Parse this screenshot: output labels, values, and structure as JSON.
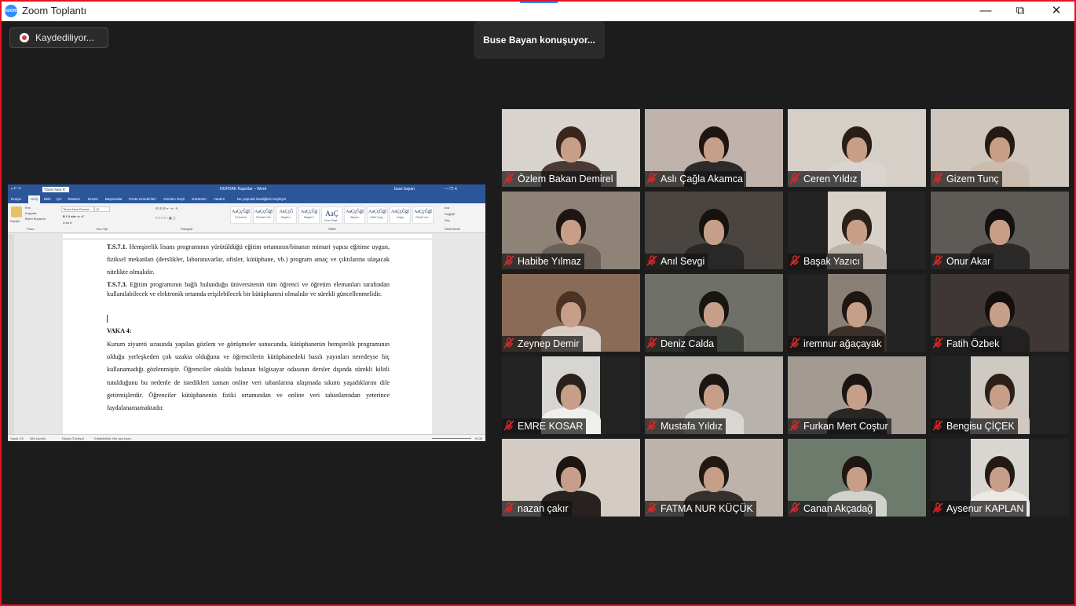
{
  "window": {
    "title": "Zoom Toplantı",
    "app_icon": "zoom-icon",
    "controls": {
      "minimize": "—",
      "maximize": "⧉",
      "close": "✕"
    }
  },
  "recording": {
    "label": "Kaydediliyor...",
    "icon": "record-icon",
    "color": "#d9373c"
  },
  "speaker_banner": "Buse Bayan konuşuyor...",
  "shared_screen": {
    "word": {
      "font_name": "Times New R",
      "doc_title": "HGPDAK Raporlar  –  Word",
      "user": "buse bayan",
      "tabs": [
        "Dosya",
        "Giriş",
        "Ekle",
        "Çiz",
        "Tasarım",
        "Düzen",
        "Başvurular",
        "Posta Gönderileri",
        "Gözden Geçir",
        "Görünüm",
        "Yardım",
        "Ne yapmak istediğinizi söyleyin"
      ],
      "active_tab": "Giriş",
      "clipboard": {
        "paste": "Yapıştır",
        "cut": "Kes",
        "copy": "Kopyala",
        "format_painter": "Biçim Boyacısı",
        "group": "Pano"
      },
      "font_group": {
        "font": "Times New Roman",
        "size": "12",
        "label": "Yazı Tipi"
      },
      "paragraph_label": "Paragraf",
      "styles_label": "Stiller",
      "editing": {
        "find": "Ara",
        "replace": "Değiştir",
        "select": "Seç",
        "label": "Düzenleme"
      },
      "styles": [
        {
          "sample": "AaÇçĞğİ",
          "name": "¶ Normal"
        },
        {
          "sample": "AaÇçĞğİ",
          "name": "¶ Aralık Yok"
        },
        {
          "sample": "AaÇçĞ",
          "name": "Başlık 1"
        },
        {
          "sample": "AaÇçĞğ",
          "name": "Başlık 2"
        },
        {
          "sample": "AaÇ",
          "name": "Konu Başl..."
        },
        {
          "sample": "AaÇçĞğİ",
          "name": "Altyazı"
        },
        {
          "sample": "AaÇçĞğİ",
          "name": "Hafif Vurg..."
        },
        {
          "sample": "AaÇçĞğİ",
          "name": "Vurgu"
        },
        {
          "sample": "AaÇçĞğİ",
          "name": "Güçlü Vur..."
        }
      ],
      "status": {
        "page": "Sayfa 2/3",
        "words": "365 sözcük",
        "language": "Türkçe (Türkiye)",
        "accessibility": "Erişilebilirlik: Her şey hazır",
        "zoom": "%130"
      },
      "document": {
        "p1_label": "T.S.7.1.",
        "p1_text": " Hemşirelik lisans programının yürütüldüğü eğitim ortamının/binanın mimari yapısı eğitime uygun, fiziksel mekanları (derslikler, laboratuvarlar, ofisler, kütüphane, vb.) program amaç ve çıktılarına ulaşacak nitelikte olmalıdır.",
        "p2_label": "T.S.7.3.",
        "p2_text": " Eğitim programının bağlı bulunduğu üniversitenin tüm öğrenci ve öğretim elemanları tarafından kullanılabilecek ve elektronik ortamda erişilebilecek bir kütüphanesi olmalıdır ve sürekli güncellenmelidir.",
        "heading": "VAKA 4:",
        "p3_text": " Kurum ziyareti sırasında yapılan gözlem ve görüşmeler sonucunda, kütüphanenin hemşirelik programının olduğu yerleşkeden çok uzakta olduğunu ve öğrencilerin kütüphanedeki basılı yayınları neredeyse hiç kullanamadığı gözlenmiştir. Öğrenciler okulda bulunan bilgisayar odasının dersler dışında sürekli kilitli tutulduğunu bu nedenle de istedikleri zaman online veri tabanlarına ulaşmada sıkıntı yaşadıklarını dile getirmişlerdir.  Öğrenciler kütüphanenin fiziki ortamından ve online veri tabanlarından yeterince faydalanamamaktadır."
      }
    }
  },
  "participants": [
    {
      "name": "Özlem Bakan Demirel",
      "muted": true,
      "bg": "#d9d3ce",
      "cam": "full",
      "hair": "#3a261c",
      "shirt": "#4a3a36"
    },
    {
      "name": "Aslı Çağla Akamca",
      "muted": true,
      "bg": "#bfb3ab",
      "cam": "full",
      "hair": "#1f1612",
      "shirt": "#2e2a2c"
    },
    {
      "name": "Ceren Yıldız",
      "muted": true,
      "bg": "#d6cfc8",
      "cam": "full",
      "hair": "#2a1d17",
      "shirt": "#d9d4cf"
    },
    {
      "name": "Gizem Tunç",
      "muted": true,
      "bg": "#cfc6be",
      "cam": "full",
      "hair": "#241915",
      "shirt": "#cbbcb0"
    },
    {
      "name": "Habibe Yılmaz",
      "muted": true,
      "bg": "#8f8377",
      "cam": "full",
      "hair": "#1d1511",
      "shirt": "#6b6158"
    },
    {
      "name": "Anıl Sevgi",
      "muted": true,
      "bg": "#4a4540",
      "cam": "full",
      "hair": "#151210",
      "shirt": "#2a2826"
    },
    {
      "name": "Başak Yazıcı",
      "muted": true,
      "bg": "#d7d1ca",
      "cam": "narrow",
      "hair": "#2b1f19",
      "shirt": "#bdb3ab"
    },
    {
      "name": "Onur Akar",
      "muted": true,
      "bg": "#5e5a56",
      "cam": "full",
      "hair": "#141110",
      "shirt": "#2b2a28"
    },
    {
      "name": "Zeynep Demir",
      "muted": true,
      "bg": "#8a6b57",
      "cam": "full",
      "hair": "#4a3224",
      "shirt": "#d8cec6"
    },
    {
      "name": "Deniz Calda",
      "muted": true,
      "bg": "#6f7168",
      "cam": "full",
      "hair": "#181513",
      "shirt": "#3d3f3b"
    },
    {
      "name": "iremnur ağaçayak",
      "muted": true,
      "bg": "#8a7f75",
      "cam": "narrow",
      "hair": "#1e1612",
      "shirt": "#3b302a"
    },
    {
      "name": "Fatih Özbek",
      "muted": true,
      "bg": "#3f3636",
      "cam": "full",
      "hair": "#120f0e",
      "shirt": "#222020"
    },
    {
      "name": "EMRE KOSAR",
      "muted": true,
      "bg": "#d7d5d2",
      "cam": "narrow",
      "hair": "#2a211c",
      "shirt": "#f1efec"
    },
    {
      "name": "Mustafa Yıldız",
      "muted": true,
      "bg": "#b7b2ab",
      "cam": "full",
      "hair": "#1b1614",
      "shirt": "#d9d7d3"
    },
    {
      "name": "Furkan Mert Coştur",
      "muted": true,
      "bg": "#a39a91",
      "cam": "full",
      "hair": "#1a1412",
      "shirt": "#2a2624"
    },
    {
      "name": "Bengisu ÇİÇEK",
      "muted": true,
      "bg": "#cfc9c3",
      "cam": "narrow",
      "hair": "#2c2019",
      "shirt": "#d2c8be"
    },
    {
      "name": "nazan çakır",
      "muted": true,
      "bg": "#d3cbc4",
      "cam": "full",
      "hair": "#1c1512",
      "shirt": "#27221f"
    },
    {
      "name": "FATMA NUR KÜÇÜK",
      "muted": true,
      "bg": "#bdb3ab",
      "cam": "full",
      "hair": "#221915",
      "shirt": "#34302e"
    },
    {
      "name": "Canan Akçadağ",
      "muted": true,
      "bg": "#6d7b6d",
      "cam": "full",
      "hair": "#1f1712",
      "shirt": "#cfd3cc"
    },
    {
      "name": "Aysenur KAPLAN",
      "muted": true,
      "bg": "#d9d6d2",
      "cam": "narrow",
      "hair": "#241a15",
      "shirt": "#ece9e5"
    }
  ],
  "mute_icon_color": "#e02828"
}
